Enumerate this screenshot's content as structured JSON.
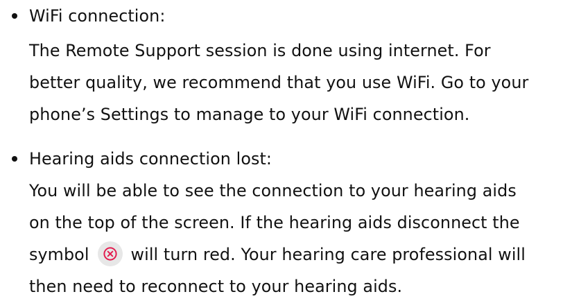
{
  "items": [
    {
      "heading": "WiFi connection:",
      "lines": [
        "The Remote Support session is done using internet. For",
        "better quality, we recommend that you use WiFi. Go to your",
        "phone’s Settings to manage to your WiFi connection."
      ]
    },
    {
      "heading": "Hearing aids connection lost:",
      "lines": [
        "You will be able to see the connection to your hearing aids",
        "on the top of the screen. If the hearing aids disconnect the",
        "symbol",
        "will turn red. Your hearing care professional will",
        "then need to reconnect to your hearing aids."
      ]
    }
  ],
  "icons": {
    "disconnect_symbol": "circle-x-icon",
    "bullet": "bullet-dot-icon"
  },
  "colors": {
    "text": "#111111",
    "symbol_red": "#e31c4f",
    "symbol_bg": "#e7e7e7"
  }
}
